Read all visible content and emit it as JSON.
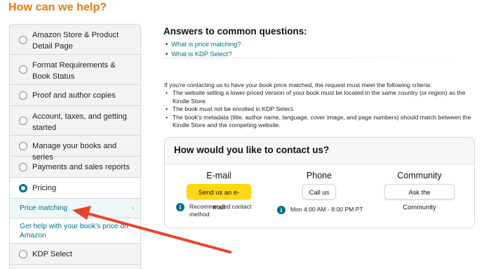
{
  "page": {
    "title": "How can we help?"
  },
  "sidebar": {
    "items": [
      {
        "label": "Amazon Store & Product Detail Page",
        "selected": false
      },
      {
        "label": "Format Requirements & Book Status",
        "selected": false
      },
      {
        "label": "Proof and author copies",
        "selected": false
      },
      {
        "label": "Account, taxes, and getting started",
        "selected": false
      },
      {
        "label": "Manage your books and series",
        "selected": false
      },
      {
        "label": "Payments and sales reports",
        "selected": false
      },
      {
        "label": "Pricing",
        "selected": true
      },
      {
        "label": "KDP Select",
        "selected": false
      }
    ],
    "subitems": [
      {
        "label": "Price matching",
        "active": true
      },
      {
        "label": "Get help with your book's price on Amazon",
        "active": false
      }
    ]
  },
  "answers": {
    "title": "Answers to common questions:",
    "links": [
      "What is price matching?",
      "What is KDP Select?"
    ]
  },
  "info": {
    "intro": "If you're contacting us to have your book price matched, the request must meet the following criteria:",
    "criteria": [
      "The website selling a lower-priced version of your book must be located in the same country (or region) as the Kindle Store.",
      "The book must not be enrolled in KDP Select.",
      "The book's metadata (title, author name, language, cover image, and page numbers) should match between the Kindle Store and the competing website."
    ]
  },
  "contact": {
    "title": "How would you like to contact us?",
    "email": {
      "title": "E-mail",
      "button": "Send us an e-mail",
      "note": "Recommended contact method"
    },
    "phone": {
      "title": "Phone",
      "button": "Call us",
      "note": "Mon 4:00 AM - 8:00 PM PT"
    },
    "community": {
      "title": "Community",
      "button": "Ask the Community"
    }
  },
  "colors": {
    "accent_orange": "#e47911",
    "link_teal": "#007185",
    "button_yellow": "#ffd814",
    "arrow_red": "#e8442b"
  },
  "icons": {
    "info": "info-circle-icon",
    "chevron": "chevron-right-icon",
    "annotation": "red-arrow-annotation"
  }
}
